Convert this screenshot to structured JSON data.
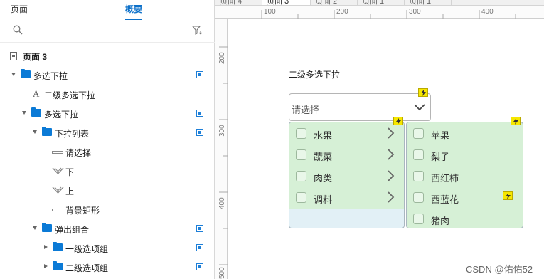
{
  "left_panel": {
    "tabs": [
      {
        "label": "页面",
        "active": false
      },
      {
        "label": "概要",
        "active": true
      }
    ],
    "search": {
      "placeholder": ""
    },
    "tree": [
      {
        "label": "页面 3",
        "icon": "page-icon",
        "bold": true
      },
      {
        "label": "多选下拉",
        "icon": "folder-icon",
        "expanded": true,
        "visible_toggle": true
      },
      {
        "label": "二级多选下拉",
        "icon": "text-icon"
      },
      {
        "label": "多选下拉",
        "icon": "folder-icon",
        "expanded": true,
        "visible_toggle": true
      },
      {
        "label": "下拉列表",
        "icon": "folder-icon",
        "expanded": true,
        "visible_toggle": true
      },
      {
        "label": "请选择",
        "icon": "rectangle-icon"
      },
      {
        "label": "下",
        "icon": "chevron-down-icon"
      },
      {
        "label": "上",
        "icon": "chevron-up-icon"
      },
      {
        "label": "背景矩形",
        "icon": "rectangle-icon"
      },
      {
        "label": "弹出组合",
        "icon": "folder-icon",
        "expanded": true,
        "visible_toggle": true
      },
      {
        "label": "一级选项组",
        "icon": "folder-icon",
        "expanded": false,
        "visible_toggle": true
      },
      {
        "label": "二级选项组",
        "icon": "folder-icon",
        "expanded": false,
        "visible_toggle": true
      }
    ]
  },
  "page_tabs": [
    {
      "label": "页面 4",
      "active": false
    },
    {
      "label": "页面 3",
      "active": true
    },
    {
      "label": "页面 2",
      "active": false
    },
    {
      "label": "页面 1",
      "active": false
    },
    {
      "label": "页面 1",
      "active": false
    }
  ],
  "ruler": {
    "h_labels": [
      "100",
      "200",
      "300",
      "400"
    ],
    "v_labels": [
      "200",
      "300",
      "400",
      "500"
    ]
  },
  "canvas": {
    "widget_title": "二级多选下拉",
    "select": {
      "placeholder": "请选择"
    },
    "level1_options": [
      "水果",
      "蔬菜",
      "肉类",
      "调料"
    ],
    "level2_options": [
      "苹果",
      "梨子",
      "西红柿",
      "西蓝花",
      "猪肉"
    ]
  },
  "watermark": "CSDN @佑佑52",
  "colors": {
    "accent": "#0c70c9",
    "option_bg": "#d6f0d6",
    "panel_bg": "#e2f0f6",
    "interaction_marker": "#f6e700"
  }
}
